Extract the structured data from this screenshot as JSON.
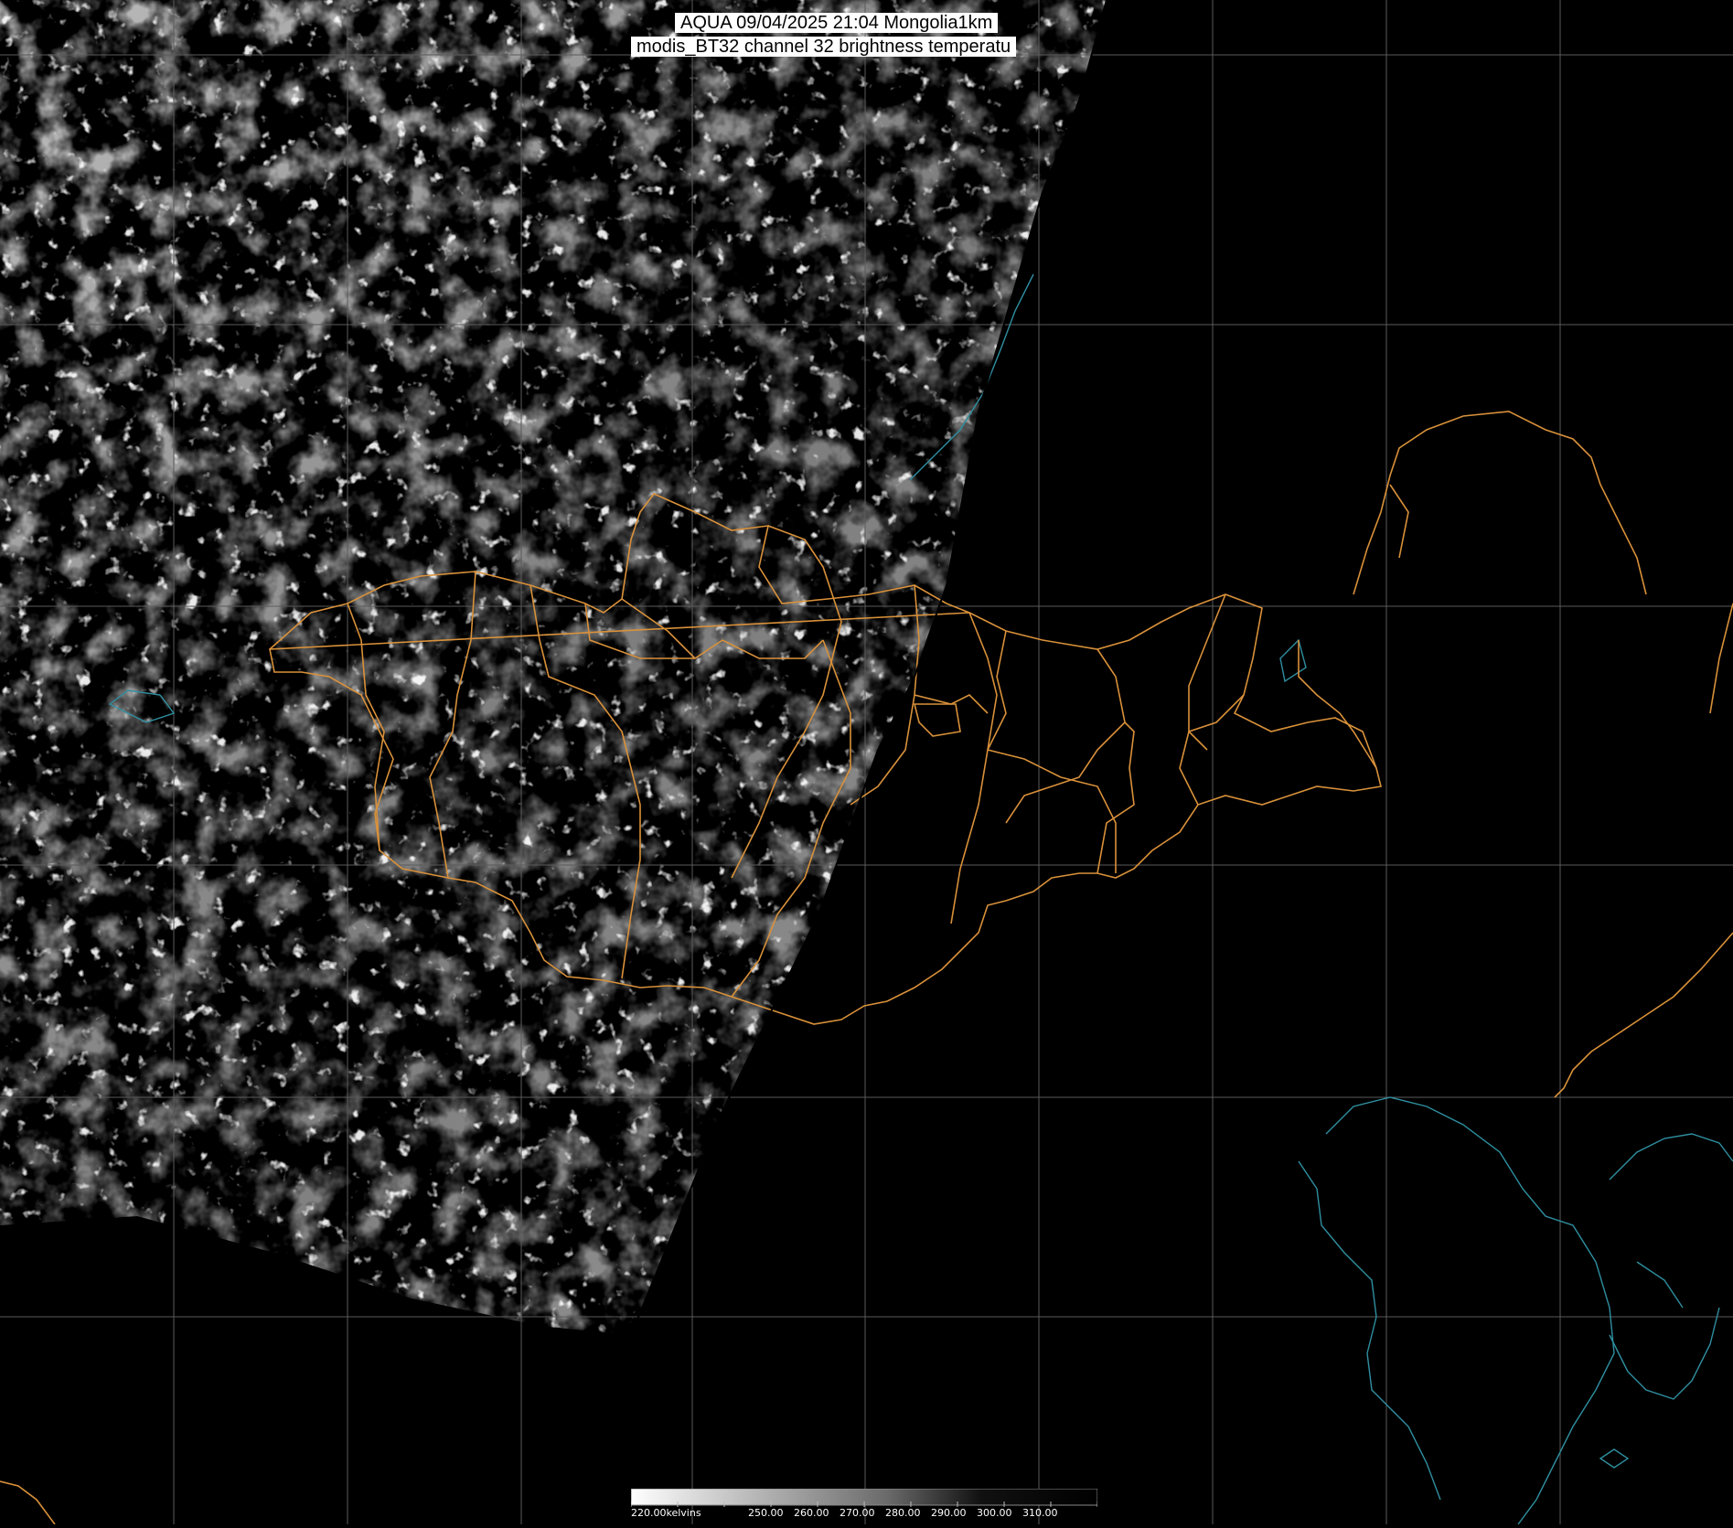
{
  "title": {
    "line1": "AQUA 09/04/2025 21:04 Mongolia1km",
    "line2": "modis_BT32 channel 32 brightness temperatu"
  },
  "colorbar": {
    "unit_label": "220.00kelvins",
    "ticks": [
      "250.00",
      "260.00",
      "270.00",
      "280.00",
      "290.00",
      "300.00",
      "310.00"
    ],
    "range_k": [
      220,
      320
    ]
  },
  "colors": {
    "background": "#000000",
    "grid": "#5a5a5a",
    "borders": "#d9913a",
    "coastline": "#2f8fa0"
  }
}
